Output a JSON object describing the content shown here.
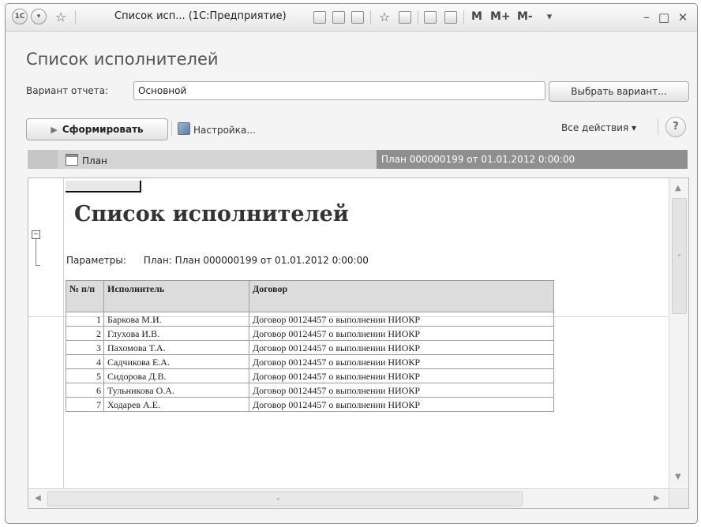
{
  "window": {
    "title": "Список исп...  (1С:Предприятие)",
    "memory_buttons": [
      "M",
      "M+",
      "M-"
    ],
    "app_icon": "1c-logo-icon"
  },
  "form": {
    "title": "Список исполнителей",
    "variant_label": "Вариант отчета:",
    "variant_value": "Основной",
    "select_variant_button": "Выбрать вариант...",
    "generate_button": "Сформировать",
    "settings_button": "Настройка...",
    "all_actions": "Все действия ▾",
    "help": "?"
  },
  "parameter_bar": {
    "label": "План",
    "value": "План 000000199 от 01.01.2012 0:00:00"
  },
  "report": {
    "title": "Список исполнителей",
    "params_label": "Параметры:",
    "params_value": "План: План 000000199 от 01.01.2012 0:00:00",
    "columns": {
      "num": "№ п/п",
      "executor": "Исполнитель",
      "contract": "Договор"
    },
    "rows": [
      {
        "num": "1",
        "executor": "Баркова М.И.",
        "contract": "Договор 00124457 о выполнении НИОКР"
      },
      {
        "num": "2",
        "executor": "Глухова И.В.",
        "contract": "Договор 00124457 о выполнении НИОКР"
      },
      {
        "num": "3",
        "executor": "Пахомова Т.А.",
        "contract": "Договор 00124457 о выполнении НИОКР"
      },
      {
        "num": "4",
        "executor": "Садчикова Е.А.",
        "contract": "Договор 00124457 о выполнении НИОКР"
      },
      {
        "num": "5",
        "executor": "Сидорова  Д.В.",
        "contract": "Договор 00124457 о выполнении НИОКР"
      },
      {
        "num": "6",
        "executor": "Тульникова О.А.",
        "contract": "Договор 00124457 о выполнении НИОКР"
      },
      {
        "num": "7",
        "executor": "Ходарев А.Е.",
        "contract": "Договор 00124457 о выполнении НИОКР"
      }
    ]
  },
  "colors": {
    "param_bar": "#d4d4d4",
    "param_value_bg": "#8f8f8f",
    "table_header": "#dcdcdc"
  }
}
